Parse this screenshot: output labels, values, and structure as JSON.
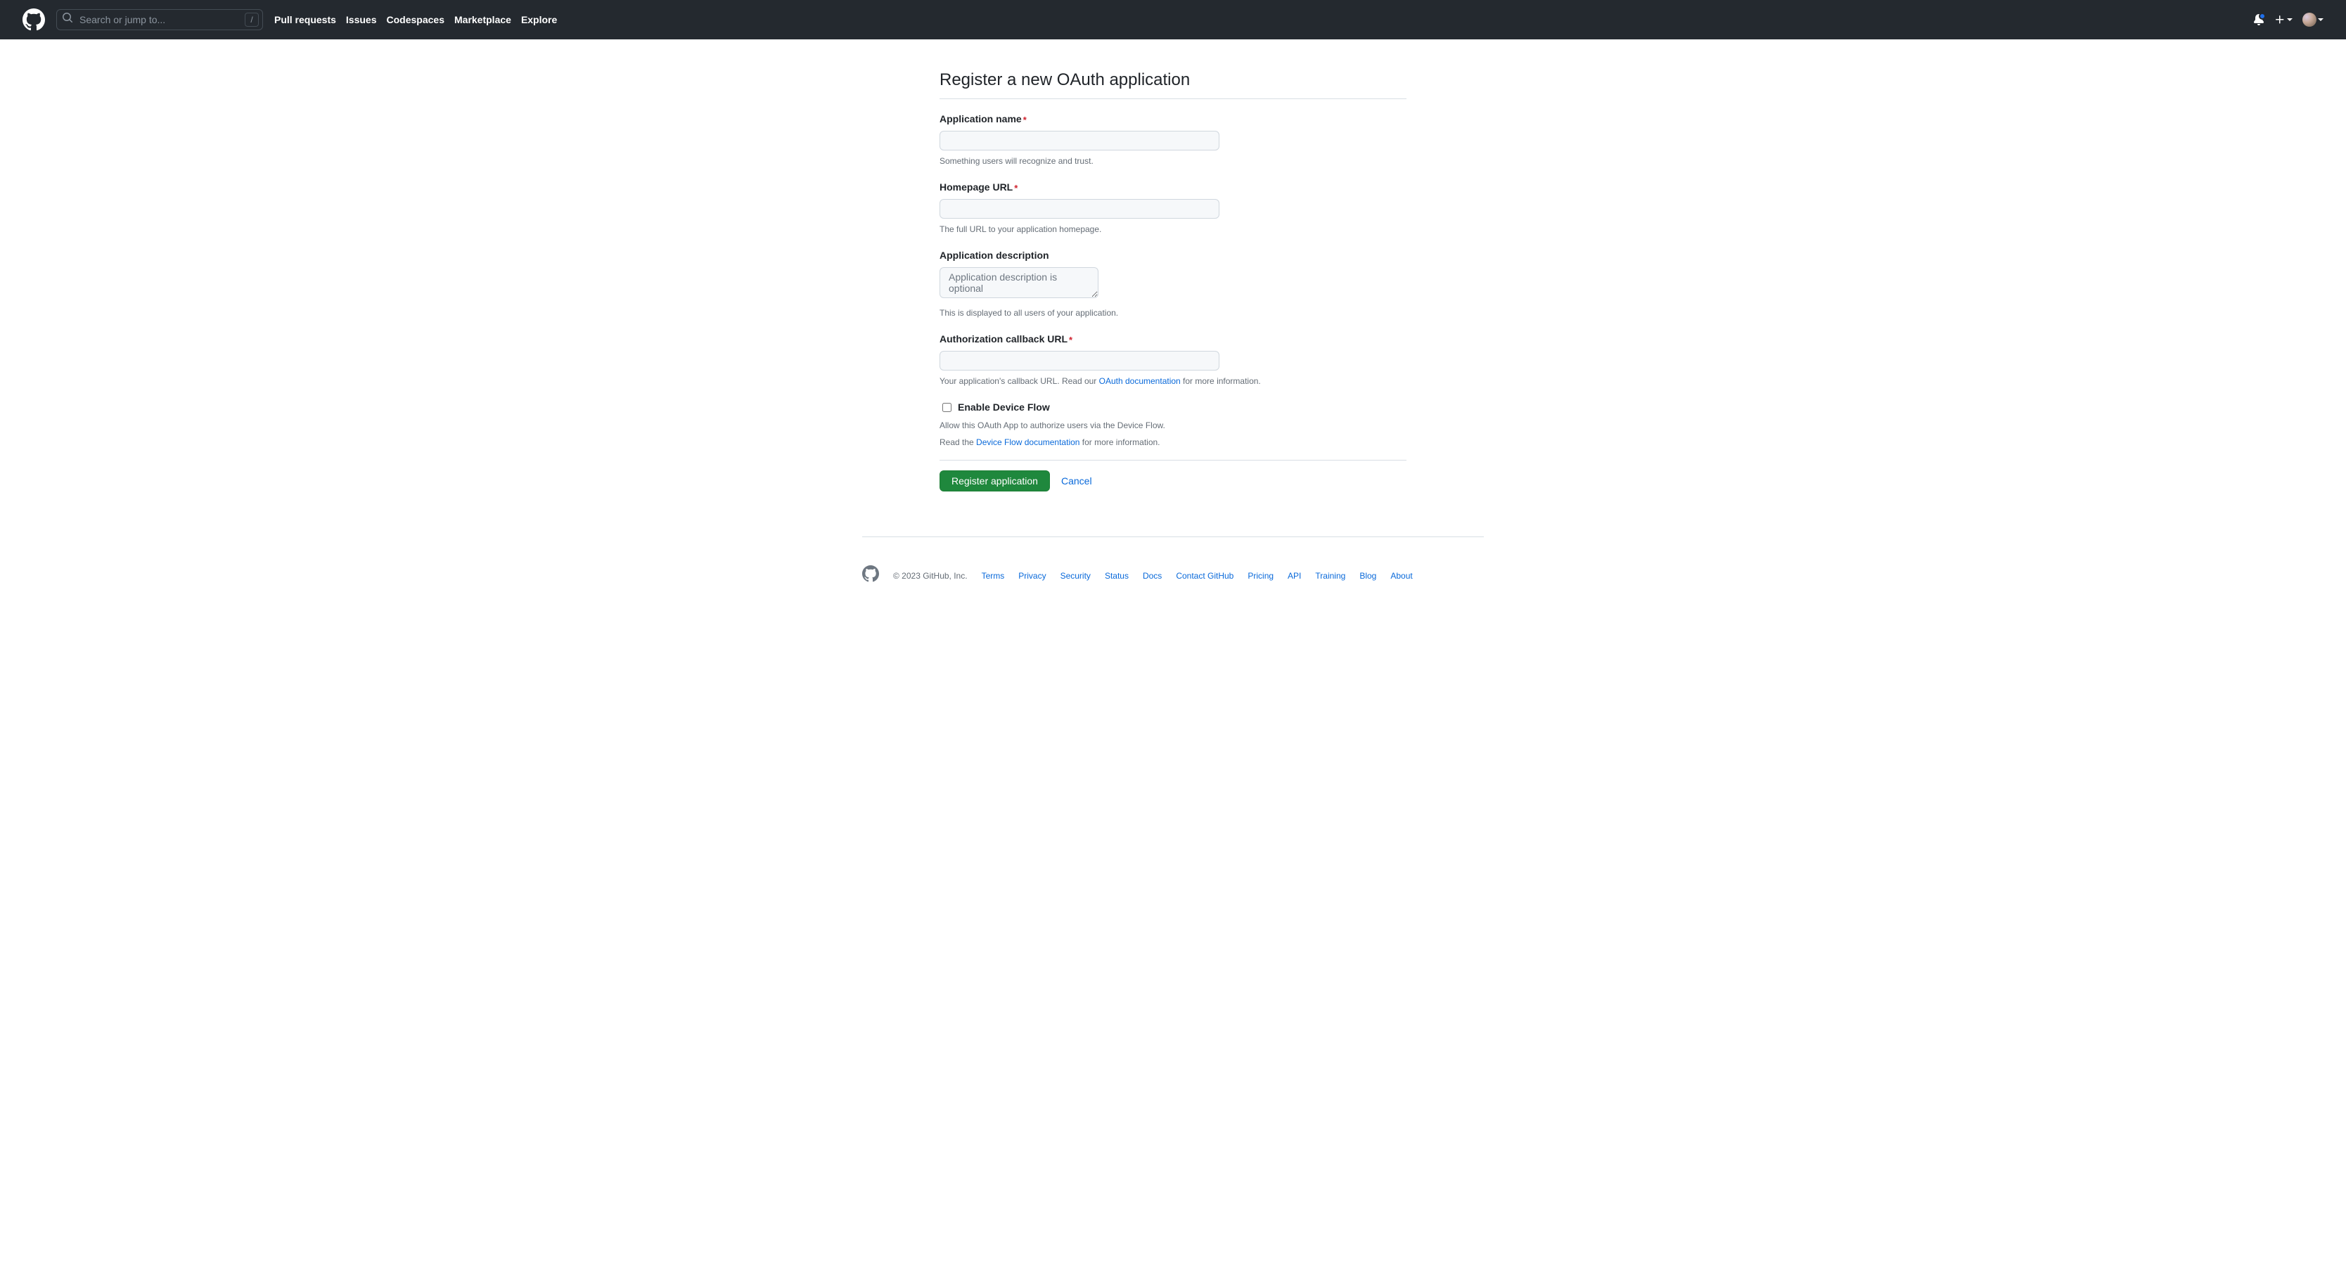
{
  "header": {
    "search_placeholder": "Search or jump to...",
    "slash_key": "/",
    "nav": {
      "pulls": "Pull requests",
      "issues": "Issues",
      "codespaces": "Codespaces",
      "marketplace": "Marketplace",
      "explore": "Explore"
    }
  },
  "page": {
    "title": "Register a new OAuth application"
  },
  "form": {
    "app_name": {
      "label": "Application name",
      "value": "",
      "note": "Something users will recognize and trust."
    },
    "homepage_url": {
      "label": "Homepage URL",
      "value": "",
      "note": "The full URL to your application homepage."
    },
    "description": {
      "label": "Application description",
      "placeholder": "Application description is optional",
      "value": "",
      "note": "This is displayed to all users of your application."
    },
    "callback_url": {
      "label": "Authorization callback URL",
      "value": "",
      "note_pre": "Your application's callback URL. Read our ",
      "note_link": "OAuth documentation",
      "note_post": " for more information."
    },
    "device_flow": {
      "label": "Enable Device Flow",
      "line1": "Allow this OAuth App to authorize users via the Device Flow.",
      "line2_pre": "Read the ",
      "line2_link": "Device Flow documentation",
      "line2_post": " for more information."
    },
    "actions": {
      "submit": "Register application",
      "cancel": "Cancel"
    }
  },
  "footer": {
    "copyright": "© 2023 GitHub, Inc.",
    "links": {
      "terms": "Terms",
      "privacy": "Privacy",
      "security": "Security",
      "status": "Status",
      "docs": "Docs",
      "contact": "Contact GitHub",
      "pricing": "Pricing",
      "api": "API",
      "training": "Training",
      "blog": "Blog",
      "about": "About"
    }
  }
}
